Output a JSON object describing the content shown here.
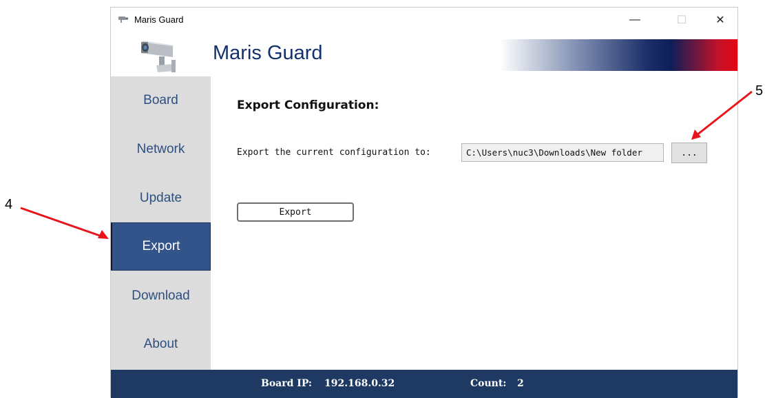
{
  "window": {
    "title": "Maris Guard",
    "controls": {
      "minimize": "—",
      "maximize": "☐",
      "close": "✕"
    }
  },
  "header": {
    "app_title": "Maris Guard",
    "logo_icon": "security-camera-icon",
    "gradient_colors": [
      "#ffffff",
      "#1c2f6b",
      "#e30613"
    ]
  },
  "sidebar": {
    "items": [
      {
        "label": "Board",
        "active": false
      },
      {
        "label": "Network",
        "active": false
      },
      {
        "label": "Update",
        "active": false
      },
      {
        "label": "Export",
        "active": true
      },
      {
        "label": "Download",
        "active": false
      },
      {
        "label": "About",
        "active": false
      }
    ],
    "active_color": "#33548a"
  },
  "main": {
    "heading": "Export Configuration:",
    "export_label": "Export the current configuration to:",
    "path_value": "C:\\Users\\nuc3\\Downloads\\New folder",
    "browse_label": "...",
    "export_button_label": "Export"
  },
  "status": {
    "ip_label": "Board IP:",
    "ip_value": "192.168.0.32",
    "count_label": "Count:",
    "count_value": "2"
  },
  "annotations": {
    "marker_4": "4",
    "marker_5": "5",
    "arrow_color": "#e8141b"
  }
}
